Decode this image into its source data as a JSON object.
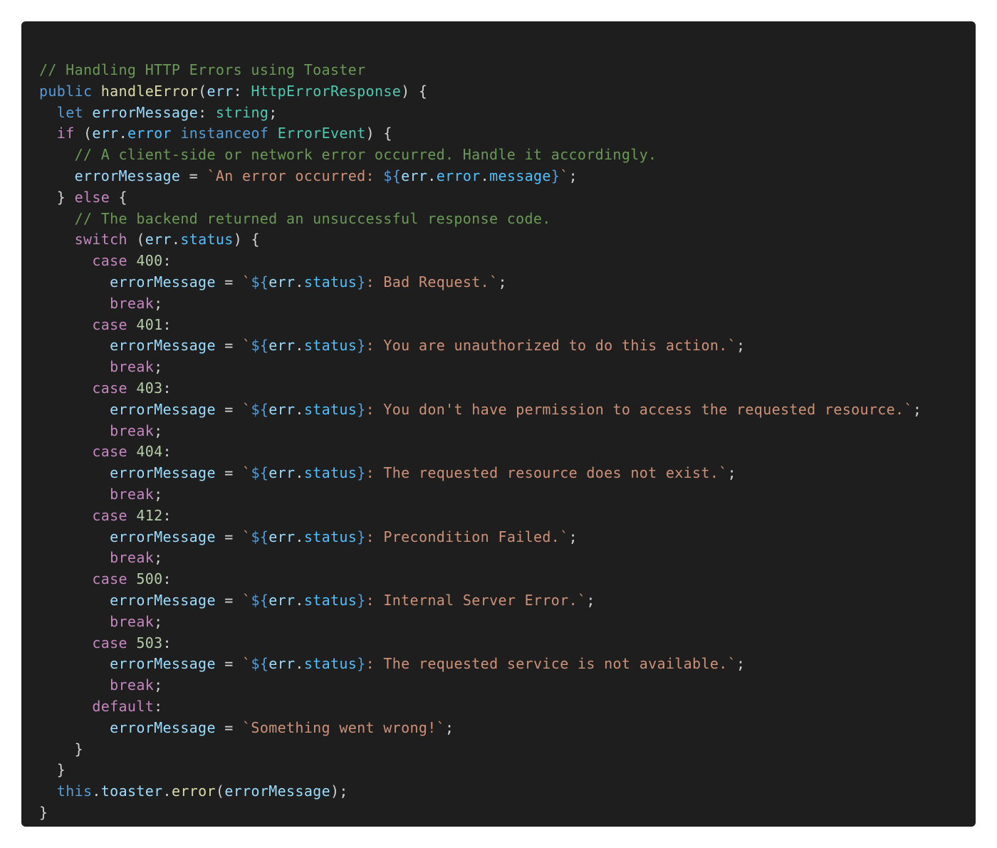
{
  "code": {
    "lines": [
      [
        {
          "t": "// Handling HTTP Errors using Toaster",
          "k": "comment"
        }
      ],
      [
        {
          "t": "public",
          "k": "kw-blue"
        },
        {
          "t": " ",
          "k": "punct"
        },
        {
          "t": "handleError",
          "k": "fn"
        },
        {
          "t": "(",
          "k": "punct"
        },
        {
          "t": "err",
          "k": "var"
        },
        {
          "t": ": ",
          "k": "punct"
        },
        {
          "t": "HttpErrorResponse",
          "k": "type"
        },
        {
          "t": ") {",
          "k": "punct"
        }
      ],
      [
        {
          "t": "  ",
          "k": "punct"
        },
        {
          "t": "let",
          "k": "kw-blue"
        },
        {
          "t": " ",
          "k": "punct"
        },
        {
          "t": "errorMessage",
          "k": "var"
        },
        {
          "t": ": ",
          "k": "punct"
        },
        {
          "t": "string",
          "k": "type"
        },
        {
          "t": ";",
          "k": "punct"
        }
      ],
      [
        {
          "t": "  ",
          "k": "punct"
        },
        {
          "t": "if",
          "k": "kw-purple"
        },
        {
          "t": " (",
          "k": "punct"
        },
        {
          "t": "err",
          "k": "var"
        },
        {
          "t": ".",
          "k": "punct"
        },
        {
          "t": "error",
          "k": "prop"
        },
        {
          "t": " ",
          "k": "punct"
        },
        {
          "t": "instanceof",
          "k": "kw-blue"
        },
        {
          "t": " ",
          "k": "punct"
        },
        {
          "t": "ErrorEvent",
          "k": "type"
        },
        {
          "t": ") {",
          "k": "punct"
        }
      ],
      [
        {
          "t": "    ",
          "k": "punct"
        },
        {
          "t": "// A client-side or network error occurred. Handle it accordingly.",
          "k": "comment"
        }
      ],
      [
        {
          "t": "    ",
          "k": "punct"
        },
        {
          "t": "errorMessage",
          "k": "var"
        },
        {
          "t": " = ",
          "k": "punct"
        },
        {
          "t": "`An error occurred: ",
          "k": "str"
        },
        {
          "t": "${",
          "k": "interp"
        },
        {
          "t": "err",
          "k": "var"
        },
        {
          "t": ".",
          "k": "punct"
        },
        {
          "t": "error",
          "k": "prop"
        },
        {
          "t": ".",
          "k": "punct"
        },
        {
          "t": "message",
          "k": "prop"
        },
        {
          "t": "}",
          "k": "interp"
        },
        {
          "t": "`",
          "k": "str"
        },
        {
          "t": ";",
          "k": "punct"
        }
      ],
      [
        {
          "t": "  } ",
          "k": "punct"
        },
        {
          "t": "else",
          "k": "kw-purple"
        },
        {
          "t": " {",
          "k": "punct"
        }
      ],
      [
        {
          "t": "    ",
          "k": "punct"
        },
        {
          "t": "// The backend returned an unsuccessful response code.",
          "k": "comment"
        }
      ],
      [
        {
          "t": "    ",
          "k": "punct"
        },
        {
          "t": "switch",
          "k": "kw-purple"
        },
        {
          "t": " (",
          "k": "punct"
        },
        {
          "t": "err",
          "k": "var"
        },
        {
          "t": ".",
          "k": "punct"
        },
        {
          "t": "status",
          "k": "prop"
        },
        {
          "t": ") {",
          "k": "punct"
        }
      ],
      [
        {
          "t": "      ",
          "k": "punct"
        },
        {
          "t": "case",
          "k": "kw-purple"
        },
        {
          "t": " ",
          "k": "punct"
        },
        {
          "t": "400",
          "k": "num"
        },
        {
          "t": ":",
          "k": "punct"
        }
      ],
      [
        {
          "t": "        ",
          "k": "punct"
        },
        {
          "t": "errorMessage",
          "k": "var"
        },
        {
          "t": " = ",
          "k": "punct"
        },
        {
          "t": "`",
          "k": "str"
        },
        {
          "t": "${",
          "k": "interp"
        },
        {
          "t": "err",
          "k": "var"
        },
        {
          "t": ".",
          "k": "punct"
        },
        {
          "t": "status",
          "k": "prop"
        },
        {
          "t": "}",
          "k": "interp"
        },
        {
          "t": ": Bad Request.`",
          "k": "str"
        },
        {
          "t": ";",
          "k": "punct"
        }
      ],
      [
        {
          "t": "        ",
          "k": "punct"
        },
        {
          "t": "break",
          "k": "kw-purple"
        },
        {
          "t": ";",
          "k": "punct"
        }
      ],
      [
        {
          "t": "      ",
          "k": "punct"
        },
        {
          "t": "case",
          "k": "kw-purple"
        },
        {
          "t": " ",
          "k": "punct"
        },
        {
          "t": "401",
          "k": "num"
        },
        {
          "t": ":",
          "k": "punct"
        }
      ],
      [
        {
          "t": "        ",
          "k": "punct"
        },
        {
          "t": "errorMessage",
          "k": "var"
        },
        {
          "t": " = ",
          "k": "punct"
        },
        {
          "t": "`",
          "k": "str"
        },
        {
          "t": "${",
          "k": "interp"
        },
        {
          "t": "err",
          "k": "var"
        },
        {
          "t": ".",
          "k": "punct"
        },
        {
          "t": "status",
          "k": "prop"
        },
        {
          "t": "}",
          "k": "interp"
        },
        {
          "t": ": You are unauthorized to do this action.`",
          "k": "str"
        },
        {
          "t": ";",
          "k": "punct"
        }
      ],
      [
        {
          "t": "        ",
          "k": "punct"
        },
        {
          "t": "break",
          "k": "kw-purple"
        },
        {
          "t": ";",
          "k": "punct"
        }
      ],
      [
        {
          "t": "      ",
          "k": "punct"
        },
        {
          "t": "case",
          "k": "kw-purple"
        },
        {
          "t": " ",
          "k": "punct"
        },
        {
          "t": "403",
          "k": "num"
        },
        {
          "t": ":",
          "k": "punct"
        }
      ],
      [
        {
          "t": "        ",
          "k": "punct"
        },
        {
          "t": "errorMessage",
          "k": "var"
        },
        {
          "t": " = ",
          "k": "punct"
        },
        {
          "t": "`",
          "k": "str"
        },
        {
          "t": "${",
          "k": "interp"
        },
        {
          "t": "err",
          "k": "var"
        },
        {
          "t": ".",
          "k": "punct"
        },
        {
          "t": "status",
          "k": "prop"
        },
        {
          "t": "}",
          "k": "interp"
        },
        {
          "t": ": You don't have permission to access the requested resource.`",
          "k": "str"
        },
        {
          "t": ";",
          "k": "punct"
        }
      ],
      [
        {
          "t": "        ",
          "k": "punct"
        },
        {
          "t": "break",
          "k": "kw-purple"
        },
        {
          "t": ";",
          "k": "punct"
        }
      ],
      [
        {
          "t": "      ",
          "k": "punct"
        },
        {
          "t": "case",
          "k": "kw-purple"
        },
        {
          "t": " ",
          "k": "punct"
        },
        {
          "t": "404",
          "k": "num"
        },
        {
          "t": ":",
          "k": "punct"
        }
      ],
      [
        {
          "t": "        ",
          "k": "punct"
        },
        {
          "t": "errorMessage",
          "k": "var"
        },
        {
          "t": " = ",
          "k": "punct"
        },
        {
          "t": "`",
          "k": "str"
        },
        {
          "t": "${",
          "k": "interp"
        },
        {
          "t": "err",
          "k": "var"
        },
        {
          "t": ".",
          "k": "punct"
        },
        {
          "t": "status",
          "k": "prop"
        },
        {
          "t": "}",
          "k": "interp"
        },
        {
          "t": ": The requested resource does not exist.`",
          "k": "str"
        },
        {
          "t": ";",
          "k": "punct"
        }
      ],
      [
        {
          "t": "        ",
          "k": "punct"
        },
        {
          "t": "break",
          "k": "kw-purple"
        },
        {
          "t": ";",
          "k": "punct"
        }
      ],
      [
        {
          "t": "      ",
          "k": "punct"
        },
        {
          "t": "case",
          "k": "kw-purple"
        },
        {
          "t": " ",
          "k": "punct"
        },
        {
          "t": "412",
          "k": "num"
        },
        {
          "t": ":",
          "k": "punct"
        }
      ],
      [
        {
          "t": "        ",
          "k": "punct"
        },
        {
          "t": "errorMessage",
          "k": "var"
        },
        {
          "t": " = ",
          "k": "punct"
        },
        {
          "t": "`",
          "k": "str"
        },
        {
          "t": "${",
          "k": "interp"
        },
        {
          "t": "err",
          "k": "var"
        },
        {
          "t": ".",
          "k": "punct"
        },
        {
          "t": "status",
          "k": "prop"
        },
        {
          "t": "}",
          "k": "interp"
        },
        {
          "t": ": Precondition Failed.`",
          "k": "str"
        },
        {
          "t": ";",
          "k": "punct"
        }
      ],
      [
        {
          "t": "        ",
          "k": "punct"
        },
        {
          "t": "break",
          "k": "kw-purple"
        },
        {
          "t": ";",
          "k": "punct"
        }
      ],
      [
        {
          "t": "      ",
          "k": "punct"
        },
        {
          "t": "case",
          "k": "kw-purple"
        },
        {
          "t": " ",
          "k": "punct"
        },
        {
          "t": "500",
          "k": "num"
        },
        {
          "t": ":",
          "k": "punct"
        }
      ],
      [
        {
          "t": "        ",
          "k": "punct"
        },
        {
          "t": "errorMessage",
          "k": "var"
        },
        {
          "t": " = ",
          "k": "punct"
        },
        {
          "t": "`",
          "k": "str"
        },
        {
          "t": "${",
          "k": "interp"
        },
        {
          "t": "err",
          "k": "var"
        },
        {
          "t": ".",
          "k": "punct"
        },
        {
          "t": "status",
          "k": "prop"
        },
        {
          "t": "}",
          "k": "interp"
        },
        {
          "t": ": Internal Server Error.`",
          "k": "str"
        },
        {
          "t": ";",
          "k": "punct"
        }
      ],
      [
        {
          "t": "        ",
          "k": "punct"
        },
        {
          "t": "break",
          "k": "kw-purple"
        },
        {
          "t": ";",
          "k": "punct"
        }
      ],
      [
        {
          "t": "      ",
          "k": "punct"
        },
        {
          "t": "case",
          "k": "kw-purple"
        },
        {
          "t": " ",
          "k": "punct"
        },
        {
          "t": "503",
          "k": "num"
        },
        {
          "t": ":",
          "k": "punct"
        }
      ],
      [
        {
          "t": "        ",
          "k": "punct"
        },
        {
          "t": "errorMessage",
          "k": "var"
        },
        {
          "t": " = ",
          "k": "punct"
        },
        {
          "t": "`",
          "k": "str"
        },
        {
          "t": "${",
          "k": "interp"
        },
        {
          "t": "err",
          "k": "var"
        },
        {
          "t": ".",
          "k": "punct"
        },
        {
          "t": "status",
          "k": "prop"
        },
        {
          "t": "}",
          "k": "interp"
        },
        {
          "t": ": The requested service is not available.`",
          "k": "str"
        },
        {
          "t": ";",
          "k": "punct"
        }
      ],
      [
        {
          "t": "        ",
          "k": "punct"
        },
        {
          "t": "break",
          "k": "kw-purple"
        },
        {
          "t": ";",
          "k": "punct"
        }
      ],
      [
        {
          "t": "      ",
          "k": "punct"
        },
        {
          "t": "default",
          "k": "kw-purple"
        },
        {
          "t": ":",
          "k": "punct"
        }
      ],
      [
        {
          "t": "        ",
          "k": "punct"
        },
        {
          "t": "errorMessage",
          "k": "var"
        },
        {
          "t": " = ",
          "k": "punct"
        },
        {
          "t": "`Something went wrong!`",
          "k": "str"
        },
        {
          "t": ";",
          "k": "punct"
        }
      ],
      [
        {
          "t": "    }",
          "k": "punct"
        }
      ],
      [
        {
          "t": "  }",
          "k": "punct"
        }
      ],
      [
        {
          "t": "  ",
          "k": "punct"
        },
        {
          "t": "this",
          "k": "kw-blue"
        },
        {
          "t": ".",
          "k": "punct"
        },
        {
          "t": "toaster",
          "k": "var"
        },
        {
          "t": ".",
          "k": "punct"
        },
        {
          "t": "error",
          "k": "fn"
        },
        {
          "t": "(",
          "k": "punct"
        },
        {
          "t": "errorMessage",
          "k": "var"
        },
        {
          "t": ");",
          "k": "punct"
        }
      ],
      [
        {
          "t": "}",
          "k": "punct"
        }
      ]
    ]
  }
}
